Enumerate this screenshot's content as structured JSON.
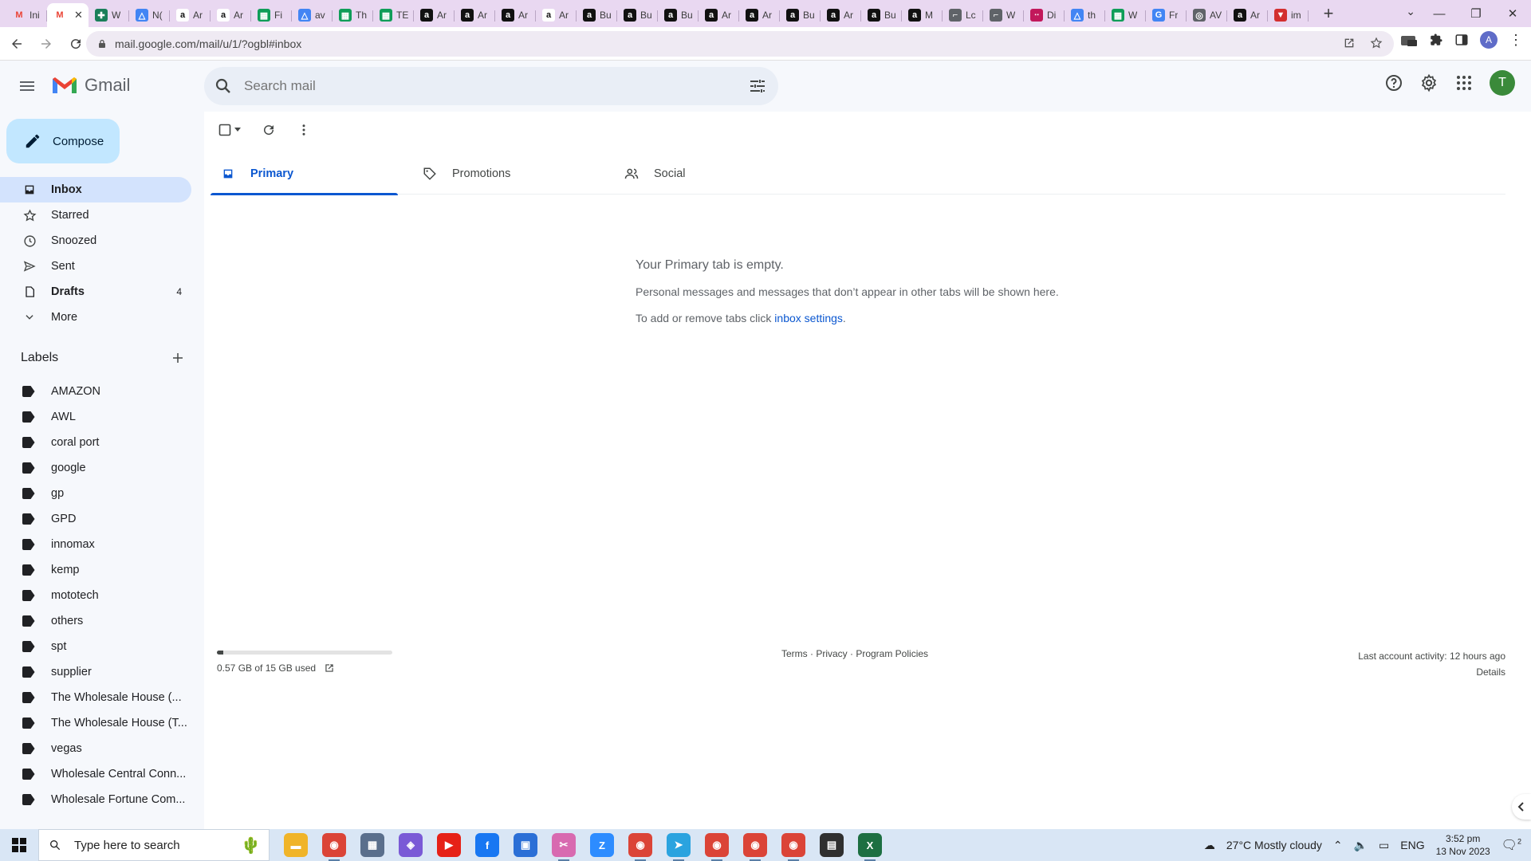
{
  "browser": {
    "tabs": [
      {
        "icon": "gmail-icon",
        "title": "Ini",
        "color": "#ea4335"
      },
      {
        "icon": "gmail-icon",
        "title": "",
        "color": "#ea4335",
        "active": true
      },
      {
        "icon": "puzzle-icon",
        "title": "W",
        "color": "#1a7f5a"
      },
      {
        "icon": "drive-icon",
        "title": "N(",
        "color": "#4285f4"
      },
      {
        "icon": "amazon-icon",
        "title": "Ar",
        "color": "#ffffff"
      },
      {
        "icon": "amazon-icon",
        "title": "Ar",
        "color": "#ffffff"
      },
      {
        "icon": "sheets-icon",
        "title": "Fi",
        "color": "#0f9d58"
      },
      {
        "icon": "drive-icon",
        "title": "av",
        "color": "#4285f4"
      },
      {
        "icon": "sheets-icon",
        "title": "Th",
        "color": "#0f9d58"
      },
      {
        "icon": "sheets-icon",
        "title": "TE",
        "color": "#0f9d58"
      },
      {
        "icon": "amazon-icon",
        "title": "Ar",
        "color": "#111111"
      },
      {
        "icon": "amazon-icon",
        "title": "Ar",
        "color": "#111111"
      },
      {
        "icon": "amazon-icon",
        "title": "Ar",
        "color": "#111111"
      },
      {
        "icon": "amazon-icon",
        "title": "Ar",
        "color": "#ffffff"
      },
      {
        "icon": "amazon-icon",
        "title": "Bu",
        "color": "#111111"
      },
      {
        "icon": "amazon-icon",
        "title": "Bu",
        "color": "#111111"
      },
      {
        "icon": "amazon-icon",
        "title": "Bu",
        "color": "#111111"
      },
      {
        "icon": "amazon-icon",
        "title": "Ar",
        "color": "#111111"
      },
      {
        "icon": "amazon-icon",
        "title": "Ar",
        "color": "#111111"
      },
      {
        "icon": "amazon-icon",
        "title": "Bu",
        "color": "#111111"
      },
      {
        "icon": "amazon-icon",
        "title": "Ar",
        "color": "#111111"
      },
      {
        "icon": "amazon-icon",
        "title": "Bu",
        "color": "#111111"
      },
      {
        "icon": "amazon-icon",
        "title": "M",
        "color": "#111111"
      },
      {
        "icon": "link-icon",
        "title": "Lc",
        "color": "#5f6368"
      },
      {
        "icon": "link-icon",
        "title": "W",
        "color": "#5f6368"
      },
      {
        "icon": "dots-icon",
        "title": "Di",
        "color": "#c2185b"
      },
      {
        "icon": "drive-icon",
        "title": "th",
        "color": "#4285f4"
      },
      {
        "icon": "sheets-icon",
        "title": "W",
        "color": "#0f9d58"
      },
      {
        "icon": "google-icon",
        "title": "Fr",
        "color": "#4285f4"
      },
      {
        "icon": "globe-icon",
        "title": "AV",
        "color": "#5f6368"
      },
      {
        "icon": "amazon-icon",
        "title": "Ar",
        "color": "#111111"
      },
      {
        "icon": "flag-icon",
        "title": "im",
        "color": "#d32f2f"
      }
    ],
    "url": "mail.google.com/mail/u/1/?ogbl#inbox"
  },
  "gmail": {
    "logo_text": "Gmail",
    "search_placeholder": "Search mail",
    "avatar_letter": "T",
    "compose_label": "Compose",
    "nav": [
      {
        "label": "Inbox",
        "icon": "inbox-icon",
        "active": true,
        "count": ""
      },
      {
        "label": "Starred",
        "icon": "star-icon",
        "count": ""
      },
      {
        "label": "Snoozed",
        "icon": "clock-icon",
        "count": ""
      },
      {
        "label": "Sent",
        "icon": "send-icon",
        "count": ""
      },
      {
        "label": "Drafts",
        "icon": "draft-icon",
        "bold": true,
        "count": "4"
      },
      {
        "label": "More",
        "icon": "chevron-down-icon",
        "count": ""
      }
    ],
    "labels_title": "Labels",
    "labels": [
      "AMAZON",
      "AWL",
      "coral port",
      "google",
      "gp",
      "GPD",
      "innomax",
      "kemp",
      "mototech",
      "others",
      "spt",
      "supplier",
      "The Wholesale House (...",
      "The Wholesale House (T...",
      "vegas",
      "Wholesale Central Conn...",
      "Wholesale Fortune Com..."
    ],
    "inbox_tabs": [
      {
        "label": "Primary",
        "icon": "inbox-tab-icon",
        "active": true
      },
      {
        "label": "Promotions",
        "icon": "tag-icon"
      },
      {
        "label": "Social",
        "icon": "people-icon"
      }
    ],
    "empty": {
      "title": "Your Primary tab is empty.",
      "line1": "Personal messages and messages that don’t appear in other tabs will be shown here.",
      "line2_prefix": "To add or remove tabs click ",
      "line2_link": "inbox settings",
      "line2_suffix": "."
    },
    "footer": {
      "storage_text": "0.57 GB of 15 GB used",
      "storage_fraction": 0.038,
      "links": "Terms · Privacy · Program Policies",
      "activity": "Last account activity: 12 hours ago",
      "details": "Details"
    }
  },
  "taskbar": {
    "search_text": "Type here to search",
    "weather": "27°C  Mostly cloudy",
    "lang": "ENG",
    "time": "3:52 pm",
    "date": "13 Nov 2023",
    "notification_count": "2",
    "apps": [
      {
        "icon": "folder-icon",
        "color": "#f0b429"
      },
      {
        "icon": "chrome-icon",
        "color": "#db4437"
      },
      {
        "icon": "calculator-icon",
        "color": "#5a6f8c"
      },
      {
        "icon": "copilot-icon",
        "color": "#7a5ad6"
      },
      {
        "icon": "youtube-icon",
        "color": "#e62117"
      },
      {
        "icon": "facebook-icon",
        "color": "#1877f2"
      },
      {
        "icon": "store-icon",
        "color": "#2b6fd6"
      },
      {
        "icon": "snip-icon",
        "color": "#d86ab0"
      },
      {
        "icon": "zoom-icon",
        "color": "#2d8cff"
      },
      {
        "icon": "chrome-icon",
        "color": "#db4437"
      },
      {
        "icon": "telegram-icon",
        "color": "#2aa3df"
      },
      {
        "icon": "chrome-icon",
        "color": "#db4437"
      },
      {
        "icon": "chrome-icon",
        "color": "#db4437"
      },
      {
        "icon": "chrome-icon",
        "color": "#db4437"
      },
      {
        "icon": "notes-icon",
        "color": "#2f2f2f"
      },
      {
        "icon": "excel-icon",
        "color": "#1d6f42"
      }
    ]
  }
}
